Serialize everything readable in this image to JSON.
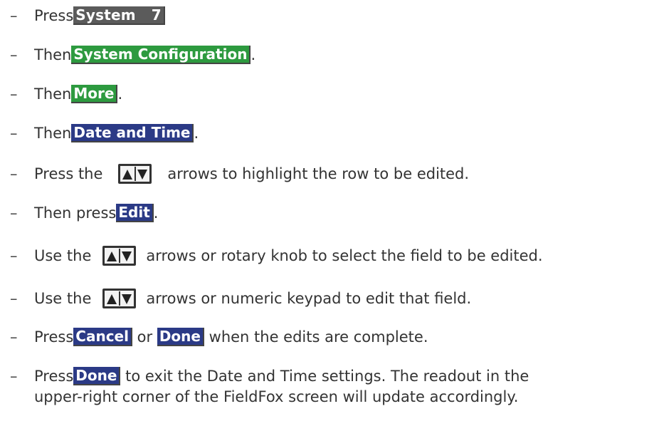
{
  "dash": "–",
  "steps": [
    {
      "pre": "Press ",
      "key": "System",
      "key_suffix": "7",
      "post": ""
    },
    {
      "pre": "Then ",
      "key": "System Configuration",
      "post": "."
    },
    {
      "pre": "Then ",
      "key": "More",
      "post": "."
    },
    {
      "pre": "Then ",
      "key": "Date and Time",
      "post": "."
    },
    {
      "pre": "Press the",
      "post": "arrows to highlight the row to be edited."
    },
    {
      "pre": "Then press ",
      "key": "Edit",
      "post": "."
    },
    {
      "pre": "Use the",
      "post": "arrows or rotary knob to select the field to be edited."
    },
    {
      "pre": "Use the",
      "post": " arrows or numeric keypad to edit that field."
    },
    {
      "pre": "Press ",
      "key": "Cancel",
      "mid": " or ",
      "key2": "Done",
      "post": " when the edits are complete."
    },
    {
      "pre": "Press ",
      "key": "Done",
      "post": " to exit the Date and Time settings. The readout in the",
      "line2": "upper-right corner of the FieldFox screen will update accordingly."
    }
  ],
  "colors": {
    "gray_key": "#5b5b5b",
    "green_key": "#2d9a3f",
    "blue_key": "#2b3a86"
  },
  "icons": [
    "up-down-arrow-keys-icon"
  ]
}
